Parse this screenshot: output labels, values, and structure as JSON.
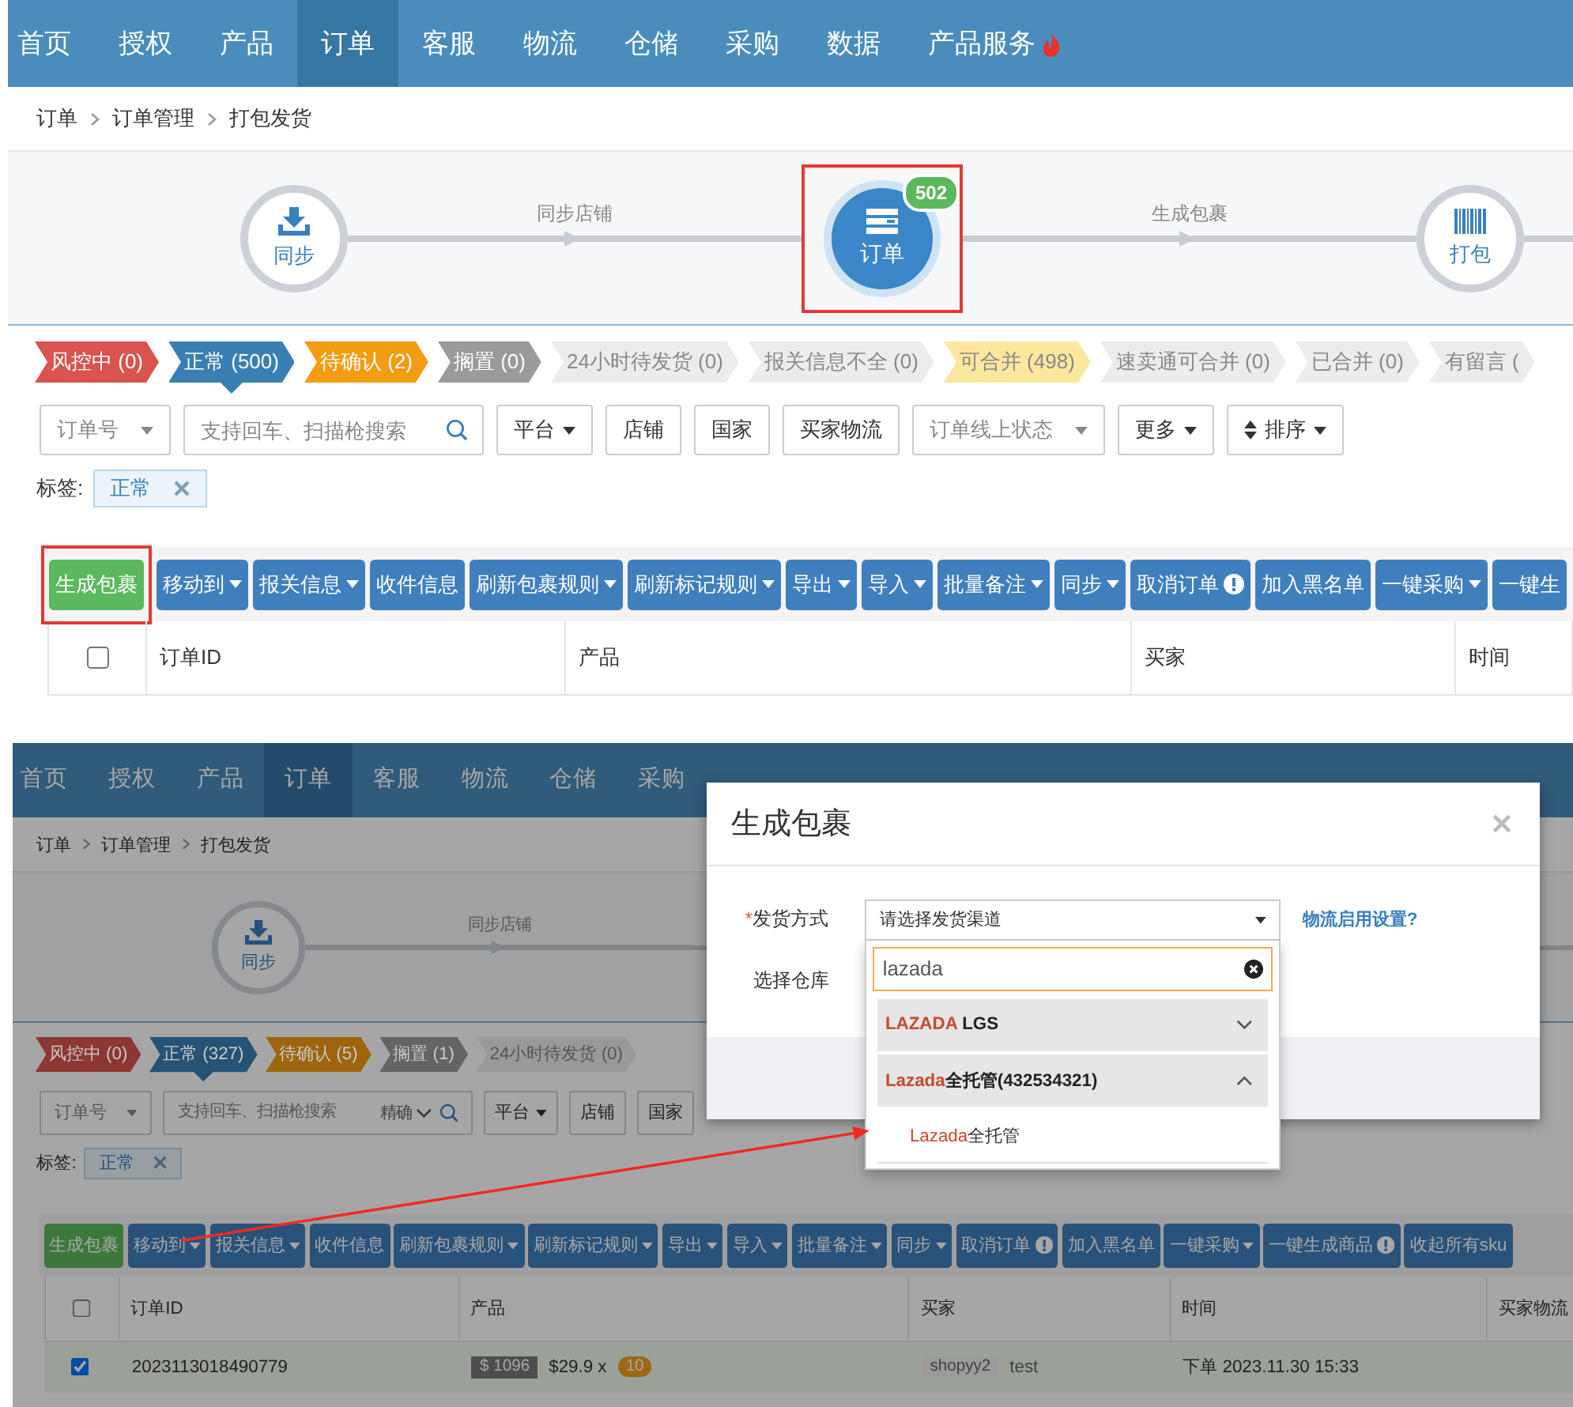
{
  "screens": [
    {
      "nav": [
        {
          "label": "首页",
          "selected": false,
          "hot": false
        },
        {
          "label": "授权",
          "selected": false,
          "hot": false
        },
        {
          "label": "产品",
          "selected": false,
          "hot": false
        },
        {
          "label": "订单",
          "selected": true,
          "hot": false
        },
        {
          "label": "客服",
          "selected": false,
          "hot": false
        },
        {
          "label": "物流",
          "selected": false,
          "hot": false
        },
        {
          "label": "仓储",
          "selected": false,
          "hot": false
        },
        {
          "label": "采购",
          "selected": false,
          "hot": false
        },
        {
          "label": "数据",
          "selected": false,
          "hot": false
        },
        {
          "label": "产品服务",
          "selected": false,
          "hot": true
        }
      ],
      "breadcrumb": [
        "订单",
        "订单管理",
        "打包发货"
      ],
      "steps": [
        {
          "kind": "sync",
          "label": "同步",
          "selected": false,
          "highlighted": false,
          "caption": "同步店铺"
        },
        {
          "kind": "orders",
          "label": "订单",
          "badge": "502",
          "selected": true,
          "highlighted": true,
          "caption": "生成包裹"
        },
        {
          "kind": "pack",
          "label": "打包",
          "selected": false,
          "highlighted": false
        }
      ],
      "status_tabs": [
        {
          "label": "风控中 (0)",
          "kind": "solid",
          "color": "#d9534f",
          "selected": false
        },
        {
          "label": "正常 (500)",
          "kind": "solid",
          "color": "#3a7fb4",
          "selected": true
        },
        {
          "label": "待确认 (2)",
          "kind": "solid",
          "color": "#f39c12",
          "selected": false
        },
        {
          "label": "搁置 (0)",
          "kind": "solid",
          "color": "#9a9a9a",
          "selected": false
        },
        {
          "label": "24小时待发货 (0)",
          "kind": "light",
          "color": "#ececec",
          "selected": false
        },
        {
          "label": "报关信息不全 (0)",
          "kind": "light",
          "color": "#ececec",
          "selected": false
        },
        {
          "label": "可合并 (498)",
          "kind": "light",
          "color": "#fce79e",
          "selected": false
        },
        {
          "label": "速卖通可合并 (0)",
          "kind": "light",
          "color": "#ececec",
          "selected": false
        },
        {
          "label": "已合并 (0)",
          "kind": "light",
          "color": "#ececec",
          "selected": false
        },
        {
          "label": "有留言 (",
          "kind": "light",
          "color": "#ececec",
          "selected": false
        }
      ],
      "filters": [
        {
          "kind": "select",
          "label": "订单号"
        },
        {
          "kind": "search",
          "placeholder": "支持回车、扫描枪搜索"
        },
        {
          "kind": "menu",
          "label": "平台"
        },
        {
          "kind": "button",
          "label": "店铺"
        },
        {
          "kind": "button",
          "label": "国家"
        },
        {
          "kind": "button",
          "label": "买家物流"
        },
        {
          "kind": "select",
          "label": "订单线上状态"
        },
        {
          "kind": "menu",
          "label": "更多"
        },
        {
          "kind": "sort",
          "label": "排序"
        }
      ],
      "tags": {
        "label": "标签:",
        "items": [
          "正常"
        ]
      },
      "toolbar": [
        {
          "label": "生成包裹",
          "kind": "primary",
          "caret": false,
          "info": false,
          "highlighted": true
        },
        {
          "label": "移动到",
          "kind": "default",
          "caret": true,
          "info": false,
          "highlighted": false
        },
        {
          "label": "报关信息",
          "kind": "default",
          "caret": true,
          "info": false,
          "highlighted": false
        },
        {
          "label": "收件信息",
          "kind": "default",
          "caret": false,
          "info": false,
          "highlighted": false
        },
        {
          "label": "刷新包裹规则",
          "kind": "default",
          "caret": true,
          "info": false,
          "highlighted": false
        },
        {
          "label": "刷新标记规则",
          "kind": "default",
          "caret": true,
          "info": false,
          "highlighted": false
        },
        {
          "label": "导出",
          "kind": "default",
          "caret": true,
          "info": false,
          "highlighted": false
        },
        {
          "label": "导入",
          "kind": "default",
          "caret": true,
          "info": false,
          "highlighted": false
        },
        {
          "label": "批量备注",
          "kind": "default",
          "caret": true,
          "info": false,
          "highlighted": false
        },
        {
          "label": "同步",
          "kind": "default",
          "caret": true,
          "info": false,
          "highlighted": false
        },
        {
          "label": "取消订单",
          "kind": "default",
          "caret": false,
          "info": true,
          "highlighted": false
        },
        {
          "label": "加入黑名单",
          "kind": "default",
          "caret": false,
          "info": false,
          "highlighted": false
        },
        {
          "label": "一键采购",
          "kind": "default",
          "caret": true,
          "info": false,
          "highlighted": false
        },
        {
          "label": "一键生",
          "kind": "default",
          "caret": false,
          "info": false,
          "highlighted": false
        }
      ],
      "table": {
        "all_checked": false,
        "columns": [
          "订单ID",
          "产品",
          "买家",
          "时间"
        ]
      }
    },
    {
      "nav": [
        {
          "label": "首页",
          "selected": false,
          "hot": false
        },
        {
          "label": "授权",
          "selected": false,
          "hot": false
        },
        {
          "label": "产品",
          "selected": false,
          "hot": false
        },
        {
          "label": "订单",
          "selected": true,
          "hot": false
        },
        {
          "label": "客服",
          "selected": false,
          "hot": false
        },
        {
          "label": "物流",
          "selected": false,
          "hot": false
        },
        {
          "label": "仓储",
          "selected": false,
          "hot": false
        },
        {
          "label": "采购",
          "selected": false,
          "hot": false
        }
      ],
      "breadcrumb": [
        "订单",
        "订单管理",
        "打包发货"
      ],
      "steps": [
        {
          "kind": "sync",
          "label": "同步",
          "selected": false,
          "highlighted": false,
          "caption": "同步店铺"
        }
      ],
      "status_tabs": [
        {
          "label": "风控中 (0)",
          "kind": "solid",
          "color": "#8d3633",
          "selected": false
        },
        {
          "label": "正常 (327)",
          "kind": "solid",
          "color": "#265375",
          "selected": true
        },
        {
          "label": "待确认 (5)",
          "kind": "solid",
          "color": "#9e650c",
          "selected": false
        },
        {
          "label": "搁置 (1)",
          "kind": "solid",
          "color": "#646464",
          "selected": false
        },
        {
          "label": "24小时待发货 (0)",
          "kind": "light",
          "color": "#999999",
          "selected": false
        }
      ],
      "filters": [
        {
          "kind": "select",
          "label": "订单号"
        },
        {
          "kind": "search",
          "placeholder": "支持回车、扫描枪搜索",
          "mode": "精确"
        },
        {
          "kind": "menu",
          "label": "平台"
        },
        {
          "kind": "button",
          "label": "店铺"
        },
        {
          "kind": "button",
          "label": "国家"
        }
      ],
      "tags": {
        "label": "标签:",
        "items": [
          "正常"
        ]
      },
      "toolbar": [
        {
          "label": "生成包裹",
          "kind": "primary",
          "caret": false,
          "info": false,
          "highlighted": false
        },
        {
          "label": "移动到",
          "kind": "default",
          "caret": true,
          "info": false,
          "highlighted": false
        },
        {
          "label": "报关信息",
          "kind": "default",
          "caret": true,
          "info": false,
          "highlighted": false
        },
        {
          "label": "收件信息",
          "kind": "default",
          "caret": false,
          "info": false,
          "highlighted": false
        },
        {
          "label": "刷新包裹规则",
          "kind": "default",
          "caret": true,
          "info": false,
          "highlighted": false
        },
        {
          "label": "刷新标记规则",
          "kind": "default",
          "caret": true,
          "info": false,
          "highlighted": false
        },
        {
          "label": "导出",
          "kind": "default",
          "caret": true,
          "info": false,
          "highlighted": false
        },
        {
          "label": "导入",
          "kind": "default",
          "caret": true,
          "info": false,
          "highlighted": false
        },
        {
          "label": "批量备注",
          "kind": "default",
          "caret": true,
          "info": false,
          "highlighted": false
        },
        {
          "label": "同步",
          "kind": "default",
          "caret": true,
          "info": false,
          "highlighted": false
        },
        {
          "label": "取消订单",
          "kind": "default",
          "caret": false,
          "info": true,
          "highlighted": false
        },
        {
          "label": "加入黑名单",
          "kind": "default",
          "caret": false,
          "info": false,
          "highlighted": false
        },
        {
          "label": "一键采购",
          "kind": "default",
          "caret": true,
          "info": false,
          "highlighted": false
        },
        {
          "label": "一键生成商品",
          "kind": "default",
          "caret": false,
          "info": true,
          "highlighted": false
        },
        {
          "label": "收起所有sku",
          "kind": "default",
          "caret": false,
          "info": false,
          "highlighted": false
        }
      ],
      "table": {
        "all_checked": false,
        "columns": [
          "订单ID",
          "产品",
          "买家",
          "时间",
          "买家物流"
        ],
        "rows": [
          {
            "checked": true,
            "order_id": "2023113018490779",
            "price_tag": "$ 1096",
            "unit_price": "$29.9 x",
            "quantity": "10",
            "buyer_shop": "shopyy2",
            "buyer_name": "test",
            "time": "下单 2023.11.30 15:33"
          }
        ]
      },
      "modal": {
        "title": "生成包裹",
        "fields": [
          {
            "required_mark": "*",
            "label": "发货方式",
            "value": "请选择发货渠道",
            "link": "物流启用设置?",
            "dropdown": {
              "search": "lazada",
              "groups": [
                {
                  "match": "LAZADA",
                  "rest": " LGS",
                  "expanded": false
                },
                {
                  "match": "Lazada",
                  "rest": "全托管(432534321)",
                  "expanded": true,
                  "options": [
                    {
                      "match": "Lazada",
                      "rest": "全托管"
                    }
                  ]
                }
              ]
            }
          },
          {
            "label": "选择仓库"
          }
        ]
      }
    }
  ]
}
